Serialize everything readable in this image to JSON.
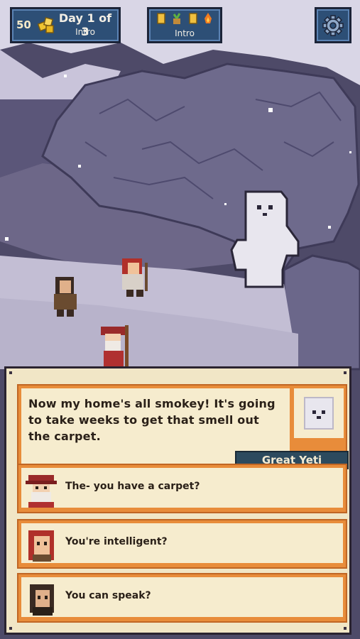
{
  "hud": {
    "coins": "50",
    "day_title": "Day 1 of 3",
    "day_phase": "Intro",
    "resource_phase": "Intro",
    "resource_icons": [
      "scroll-icon",
      "sprout-icon",
      "scroll-icon",
      "fire-icon"
    ],
    "settings_icon": "gear-icon"
  },
  "dialog": {
    "speech": "Now my home's all smokey! It's going to take weeks to get that smell out the carpet.",
    "speaker": "Great Yeti",
    "choices": [
      {
        "text": "The- you have a carpet?"
      },
      {
        "text": "You're intelligent?"
      },
      {
        "text": "You can speak?"
      }
    ]
  },
  "colors": {
    "hud_blue": "#2d4f76",
    "dialog_orange": "#e88c3a",
    "dialog_paper": "#f6ecce",
    "name_plate": "#2c4a5e"
  }
}
